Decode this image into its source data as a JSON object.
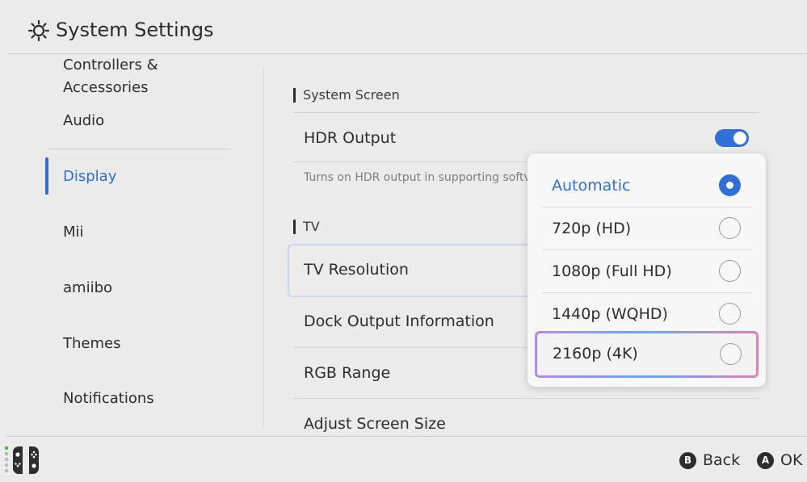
{
  "header": {
    "title": "System Settings",
    "icon": "gear-icon"
  },
  "sidebar": {
    "items": [
      {
        "label": "Controllers & Accessories"
      },
      {
        "label": "Audio"
      },
      {
        "label": "Display",
        "selected": true
      },
      {
        "label": "Mii"
      },
      {
        "label": "amiibo"
      },
      {
        "label": "Themes"
      },
      {
        "label": "Notifications"
      }
    ]
  },
  "main": {
    "sections": {
      "system_screen": "System Screen",
      "tv": "TV"
    },
    "hdr": {
      "label": "HDR Output",
      "on": true,
      "description": "Turns on HDR output in supporting softv"
    },
    "rows": {
      "tv_resolution": "TV Resolution",
      "dock_output": "Dock Output Information",
      "rgb_range": "RGB Range",
      "adjust_screen": "Adjust Screen Size"
    }
  },
  "popup": {
    "options": [
      {
        "label": "Automatic",
        "selected": true
      },
      {
        "label": "720p (HD)"
      },
      {
        "label": "1080p (Full HD)"
      },
      {
        "label": "1440p (WQHD)"
      },
      {
        "label": "2160p (4K)",
        "cursor": true
      }
    ]
  },
  "footer": {
    "back": {
      "button": "B",
      "label": "Back"
    },
    "ok": {
      "button": "A",
      "label": "OK"
    }
  },
  "colors": {
    "accent": "#2f6fd6",
    "background": "#ebebeb",
    "text": "#2d2d2d"
  }
}
